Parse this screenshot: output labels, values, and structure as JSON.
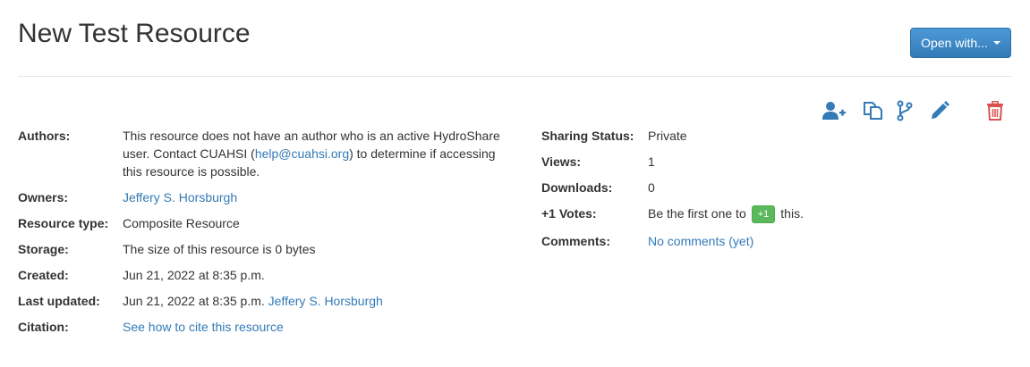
{
  "page_title": "New Test Resource",
  "open_with": {
    "label": "Open with..."
  },
  "toolbar": {
    "icons": [
      "add-user-icon",
      "copy-icon",
      "fork-icon",
      "edit-icon",
      "delete-icon"
    ],
    "colors": {
      "primary": "#337ab7",
      "danger": "#d9534f"
    }
  },
  "left_meta": {
    "authors": {
      "label": "Authors:",
      "line1": "This resource does not have an author who is an active HydroShare",
      "line2_prefix": "user. Contact CUAHSI (",
      "email": "help@cuahsi.org",
      "line2_suffix": ") to determine if accessing",
      "line3": "this resource is possible."
    },
    "owners": {
      "label": "Owners:",
      "value": "Jeffery S. Horsburgh"
    },
    "resource_type": {
      "label": "Resource type:",
      "value": "Composite Resource"
    },
    "storage": {
      "label": "Storage:",
      "value": "The size of this resource is 0 bytes"
    },
    "created": {
      "label": "Created:",
      "value": "Jun 21, 2022 at 8:35 p.m."
    },
    "last_updated": {
      "label": "Last updated:",
      "value": "Jun 21, 2022 at 8:35 p.m.",
      "user": "Jeffery S. Horsburgh"
    },
    "citation": {
      "label": "Citation:",
      "value": "See how to cite this resource"
    }
  },
  "right_meta": {
    "sharing_status": {
      "label": "Sharing Status:",
      "value": "Private"
    },
    "views": {
      "label": "Views:",
      "value": "1"
    },
    "downloads": {
      "label": "Downloads:",
      "value": "0"
    },
    "votes": {
      "label": "+1 Votes:",
      "prefix": "Be the first one to",
      "button": "+1",
      "suffix": "this."
    },
    "comments": {
      "label": "Comments:",
      "value": "No comments (yet)"
    }
  }
}
